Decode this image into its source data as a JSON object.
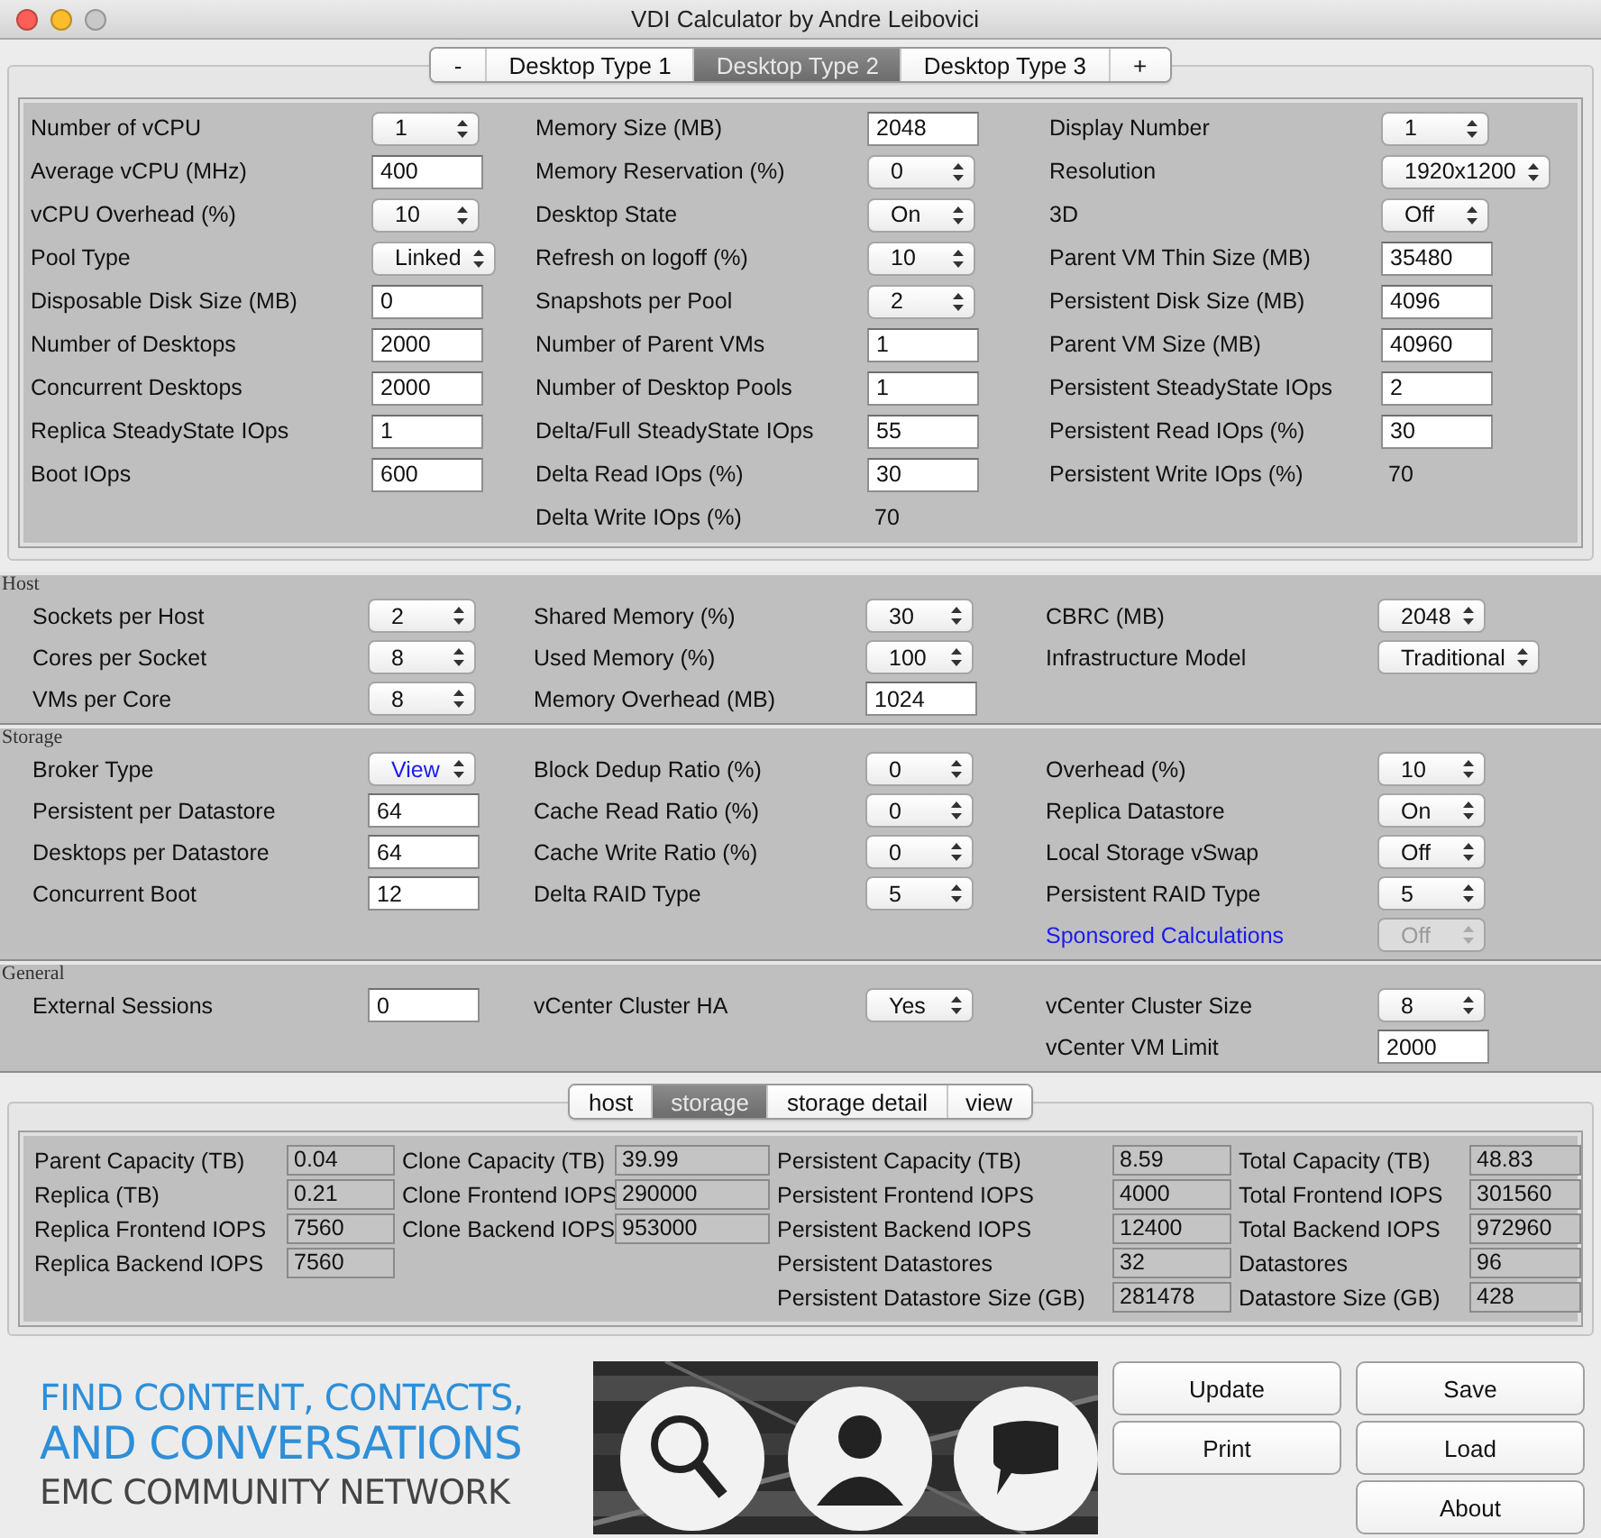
{
  "window": {
    "title": "VDI Calculator by Andre Leibovici"
  },
  "desktop_tabs": [
    {
      "label": "-",
      "selected": false
    },
    {
      "label": "Desktop Type 1",
      "selected": false
    },
    {
      "label": "Desktop Type 2",
      "selected": true
    },
    {
      "label": "Desktop Type 3",
      "selected": false
    },
    {
      "label": "+",
      "selected": false
    }
  ],
  "desktop_panel": {
    "columns": [
      [
        {
          "label": "Number of vCPU",
          "kind": "select",
          "value": "1"
        },
        {
          "label": "Average vCPU (MHz)",
          "kind": "input",
          "value": "400"
        },
        {
          "label": "vCPU Overhead (%)",
          "kind": "select",
          "value": "10"
        },
        {
          "label": "Pool Type",
          "kind": "select",
          "value": "Linked"
        },
        {
          "label": "Disposable Disk Size (MB)",
          "kind": "input",
          "value": "0"
        },
        {
          "label": "Number of Desktops",
          "kind": "input",
          "value": "2000"
        },
        {
          "label": "Concurrent Desktops",
          "kind": "input",
          "value": "2000"
        },
        {
          "label": "Replica SteadyState IOps",
          "kind": "input",
          "value": "1"
        },
        {
          "label": "Boot IOps",
          "kind": "input",
          "value": "600"
        }
      ],
      [
        {
          "label": "Memory Size (MB)",
          "kind": "input",
          "value": "2048"
        },
        {
          "label": "Memory Reservation (%)",
          "kind": "select",
          "value": "0"
        },
        {
          "label": "Desktop State",
          "kind": "select",
          "value": "On"
        },
        {
          "label": "Refresh on logoff (%)",
          "kind": "select",
          "value": "10"
        },
        {
          "label": "Snapshots per Pool",
          "kind": "select",
          "value": "2"
        },
        {
          "label": "Number of Parent VMs",
          "kind": "input",
          "value": "1"
        },
        {
          "label": "Number of Desktop Pools",
          "kind": "input",
          "value": "1"
        },
        {
          "label": "Delta/Full SteadyState IOps",
          "kind": "input",
          "value": "55"
        },
        {
          "label": "Delta Read IOps (%)",
          "kind": "input",
          "value": "30"
        },
        {
          "label": "Delta Write IOps (%)",
          "kind": "value",
          "value": "70"
        }
      ],
      [
        {
          "label": "Display Number",
          "kind": "select",
          "value": "1"
        },
        {
          "label": "Resolution",
          "kind": "select",
          "value": "1920x1200"
        },
        {
          "label": "3D",
          "kind": "select",
          "value": "Off"
        },
        {
          "label": "Parent VM Thin Size (MB)",
          "kind": "input",
          "value": "35480"
        },
        {
          "label": "Persistent Disk Size (MB)",
          "kind": "input",
          "value": "4096"
        },
        {
          "label": "Parent VM Size (MB)",
          "kind": "input",
          "value": "40960"
        },
        {
          "label": "Persistent SteadyState IOps",
          "kind": "input",
          "value": "2"
        },
        {
          "label": "Persistent Read IOps (%)",
          "kind": "input",
          "value": "30"
        },
        {
          "label": "Persistent Write IOps (%)",
          "kind": "value",
          "value": "70"
        }
      ]
    ]
  },
  "sections": [
    {
      "title": "Host",
      "columns": [
        [
          {
            "label": "Sockets per Host",
            "kind": "select",
            "value": "2"
          },
          {
            "label": "Cores per Socket",
            "kind": "select",
            "value": "8"
          },
          {
            "label": "VMs per Core",
            "kind": "select",
            "value": "8"
          }
        ],
        [
          {
            "label": "Shared Memory (%)",
            "kind": "select",
            "value": "30"
          },
          {
            "label": "Used Memory (%)",
            "kind": "select",
            "value": "100"
          },
          {
            "label": "Memory Overhead (MB)",
            "kind": "input",
            "value": "1024"
          }
        ],
        [
          {
            "label": "CBRC (MB)",
            "kind": "select",
            "value": "2048"
          },
          {
            "label": "Infrastructure Model",
            "kind": "select",
            "value": "Traditional"
          }
        ]
      ]
    },
    {
      "title": "Storage",
      "columns": [
        [
          {
            "label": "Broker Type",
            "kind": "highlighted",
            "value": "View"
          },
          {
            "label": "Persistent per Datastore",
            "kind": "input",
            "value": "64"
          },
          {
            "label": "Desktops per Datastore",
            "kind": "input",
            "value": "64"
          },
          {
            "label": "Concurrent Boot",
            "kind": "input",
            "value": "12"
          }
        ],
        [
          {
            "label": "Block Dedup Ratio (%)",
            "kind": "select",
            "value": "0"
          },
          {
            "label": "Cache Read Ratio (%)",
            "kind": "select",
            "value": "0"
          },
          {
            "label": "Cache Write Ratio (%)",
            "kind": "select",
            "value": "0"
          },
          {
            "label": "Delta RAID Type",
            "kind": "select",
            "value": "5"
          }
        ],
        [
          {
            "label": "Overhead (%)",
            "kind": "select",
            "value": "10"
          },
          {
            "label": "Replica Datastore",
            "kind": "select",
            "value": "On"
          },
          {
            "label": "Local Storage vSwap",
            "kind": "select",
            "value": "Off"
          },
          {
            "label": "Persistent RAID Type",
            "kind": "select",
            "value": "5"
          },
          {
            "label": "Sponsored Calculations",
            "kind": "locked",
            "value": "Off",
            "link": true
          }
        ]
      ]
    },
    {
      "title": "General",
      "columns": [
        [
          {
            "label": "External Sessions",
            "kind": "input",
            "value": "0"
          }
        ],
        [
          {
            "label": "vCenter Cluster HA",
            "kind": "select",
            "value": "Yes"
          }
        ],
        [
          {
            "label": "vCenter Cluster Size",
            "kind": "select",
            "value": "8"
          },
          {
            "label": "vCenter VM Limit",
            "kind": "input",
            "value": "2000"
          }
        ]
      ]
    }
  ],
  "result_tabs": [
    {
      "label": "host",
      "selected": false
    },
    {
      "label": "storage",
      "selected": true
    },
    {
      "label": "storage detail",
      "selected": false
    },
    {
      "label": "view",
      "selected": false
    }
  ],
  "results": {
    "columns": [
      [
        {
          "label": "Parent Capacity (TB)",
          "value": "0.04"
        },
        {
          "label": "Replica (TB)",
          "value": "0.21"
        },
        {
          "label": "Replica Frontend IOPS",
          "value": "7560"
        },
        {
          "label": "Replica Backend IOPS",
          "value": "7560"
        }
      ],
      [
        {
          "label": "Clone Capacity (TB)",
          "value": "39.99"
        },
        {
          "label": "Clone Frontend IOPS",
          "value": "290000"
        },
        {
          "label": "Clone Backend IOPS",
          "value": "953000"
        }
      ],
      [
        {
          "label": "Persistent Capacity (TB)",
          "value": "8.59"
        },
        {
          "label": "Persistent Frontend IOPS",
          "value": "4000"
        },
        {
          "label": "Persistent Backend IOPS",
          "value": "12400"
        },
        {
          "label": "Persistent Datastores",
          "value": "32"
        },
        {
          "label": "Persistent Datastore Size (GB)",
          "value": "281478"
        }
      ],
      [
        {
          "label": "Total Capacity (TB)",
          "value": "48.83"
        },
        {
          "label": "Total Frontend IOPS",
          "value": "301560"
        },
        {
          "label": "Total Backend IOPS",
          "value": "972960"
        },
        {
          "label": "Datastores",
          "value": "96"
        },
        {
          "label": "Datastore Size (GB)",
          "value": "428"
        }
      ]
    ]
  },
  "banner": {
    "lines": [
      {
        "text": "FIND CONTENT, CONTACTS,",
        "kind": "headline"
      },
      {
        "text": "AND CONVERSATIONS",
        "kind": "emphasis"
      },
      {
        "text": "EMC COMMUNITY NETWORK",
        "kind": "tagline"
      }
    ]
  },
  "button_columns": [
    [
      "Update",
      "Print"
    ],
    [
      "Save",
      "Load",
      "About"
    ]
  ]
}
